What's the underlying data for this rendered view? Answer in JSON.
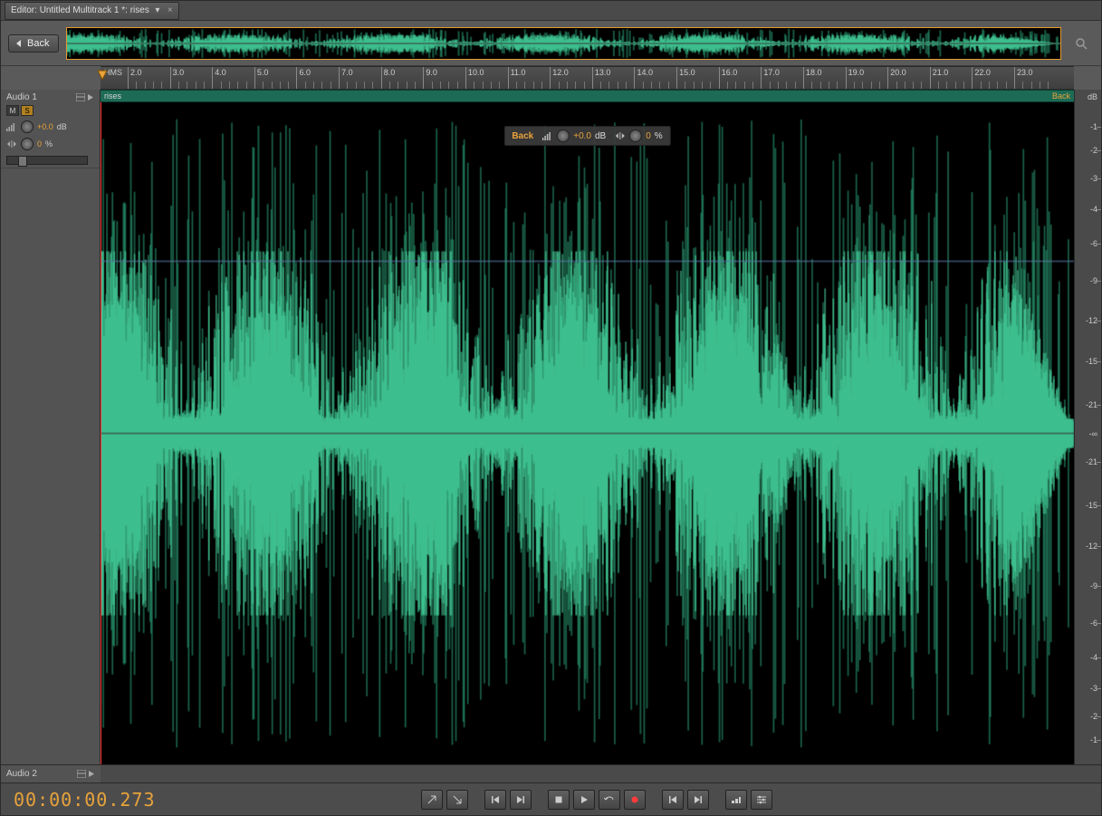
{
  "tab": {
    "prefix": "Editor:",
    "title": "Untitled Multitrack 1 *: rises"
  },
  "toolbar": {
    "back_label": "Back"
  },
  "ruler": {
    "unit": "HMS",
    "ticks": [
      "2.0",
      "3.0",
      "4.0",
      "5.0",
      "6.0",
      "7.0",
      "8.0",
      "9.0",
      "10.0",
      "11.0",
      "12.0",
      "13.0",
      "14.0",
      "15.0",
      "16.0",
      "17.0",
      "18.0",
      "19.0",
      "20.0",
      "21.0",
      "22.0",
      "23.0"
    ]
  },
  "clip": {
    "name": "rises",
    "right_label": "Back"
  },
  "track1": {
    "name": "Audio 1",
    "mute_label": "M",
    "solo_label": "S",
    "volume_db": "+0.0",
    "volume_unit": "dB",
    "pan_pct": "0",
    "pan_unit": "%"
  },
  "hud": {
    "name": "Back",
    "volume_db": "+0.0",
    "volume_unit": "dB",
    "pan_pct": "0",
    "pan_unit": "%"
  },
  "db_scale": {
    "unit": "dB",
    "labels": [
      "-1",
      "-2",
      "-3",
      "-4",
      "-6",
      "-9",
      "-12",
      "-15",
      "-21",
      "-∞",
      "-21",
      "-15",
      "-12",
      "-9",
      "-6",
      "-4",
      "-3",
      "-2",
      "-1"
    ]
  },
  "track2": {
    "name": "Audio 2"
  },
  "timecode": "00:00:00.273",
  "colors": {
    "waveform": "#4ee0a9",
    "waveform_dark": "#2aa077",
    "accent": "#e8a33c",
    "clip_bg": "#1e6b55"
  }
}
